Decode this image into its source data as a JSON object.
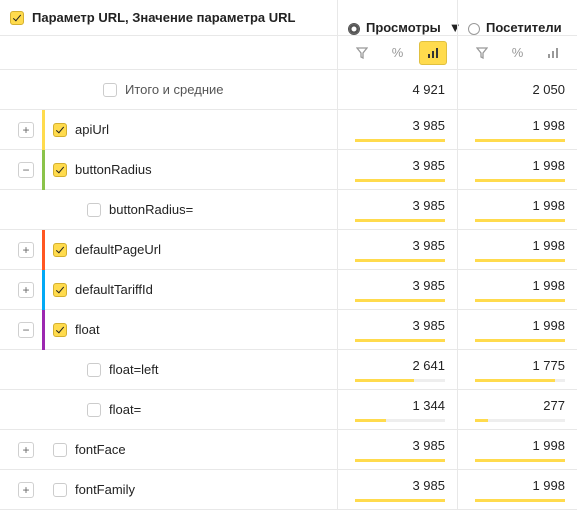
{
  "header": {
    "dimension_label": "Параметр URL, Значение параметра URL",
    "metrics": [
      {
        "label": "Просмотры",
        "sorted": true
      },
      {
        "label": "Посетители",
        "sorted": false
      }
    ]
  },
  "toolbar": {
    "buttons": [
      "filter",
      "percent",
      "chart"
    ],
    "active": [
      2,
      -1
    ]
  },
  "totals": {
    "label": "Итого и средние",
    "values": [
      "4 921",
      "2 050"
    ]
  },
  "rows": [
    {
      "label": "apiUrl",
      "exp": "plus",
      "checked": true,
      "marker": "#ffdb4d",
      "indent": 0,
      "v": [
        "3 985",
        "1 998"
      ],
      "pct": [
        100,
        100
      ]
    },
    {
      "label": "buttonRadius",
      "exp": "minus",
      "checked": true,
      "marker": "#8bc34a",
      "indent": 0,
      "v": [
        "3 985",
        "1 998"
      ],
      "pct": [
        100,
        100
      ]
    },
    {
      "label": "buttonRadius=",
      "exp": "",
      "checked": false,
      "marker": "",
      "indent": 1,
      "v": [
        "3 985",
        "1 998"
      ],
      "pct": [
        100,
        100
      ]
    },
    {
      "label": "defaultPageUrl",
      "exp": "plus",
      "checked": true,
      "marker": "#ff5722",
      "indent": 0,
      "v": [
        "3 985",
        "1 998"
      ],
      "pct": [
        100,
        100
      ]
    },
    {
      "label": "defaultTariffId",
      "exp": "plus",
      "checked": true,
      "marker": "#03a9f4",
      "indent": 0,
      "v": [
        "3 985",
        "1 998"
      ],
      "pct": [
        100,
        100
      ]
    },
    {
      "label": "float",
      "exp": "minus",
      "checked": true,
      "marker": "#9c27b0",
      "indent": 0,
      "v": [
        "3 985",
        "1 998"
      ],
      "pct": [
        100,
        100
      ]
    },
    {
      "label": "float=left",
      "exp": "",
      "checked": false,
      "marker": "",
      "indent": 1,
      "v": [
        "2 641",
        "1 775"
      ],
      "pct": [
        66,
        89
      ]
    },
    {
      "label": "float=",
      "exp": "",
      "checked": false,
      "marker": "",
      "indent": 1,
      "v": [
        "1 344",
        "277"
      ],
      "pct": [
        34,
        14
      ]
    },
    {
      "label": "fontFace",
      "exp": "plus",
      "checked": false,
      "marker": "",
      "indent": 0,
      "v": [
        "3 985",
        "1 998"
      ],
      "pct": [
        100,
        100
      ]
    },
    {
      "label": "fontFamily",
      "exp": "plus",
      "checked": false,
      "marker": "",
      "indent": 0,
      "v": [
        "3 985",
        "1 998"
      ],
      "pct": [
        100,
        100
      ]
    }
  ]
}
